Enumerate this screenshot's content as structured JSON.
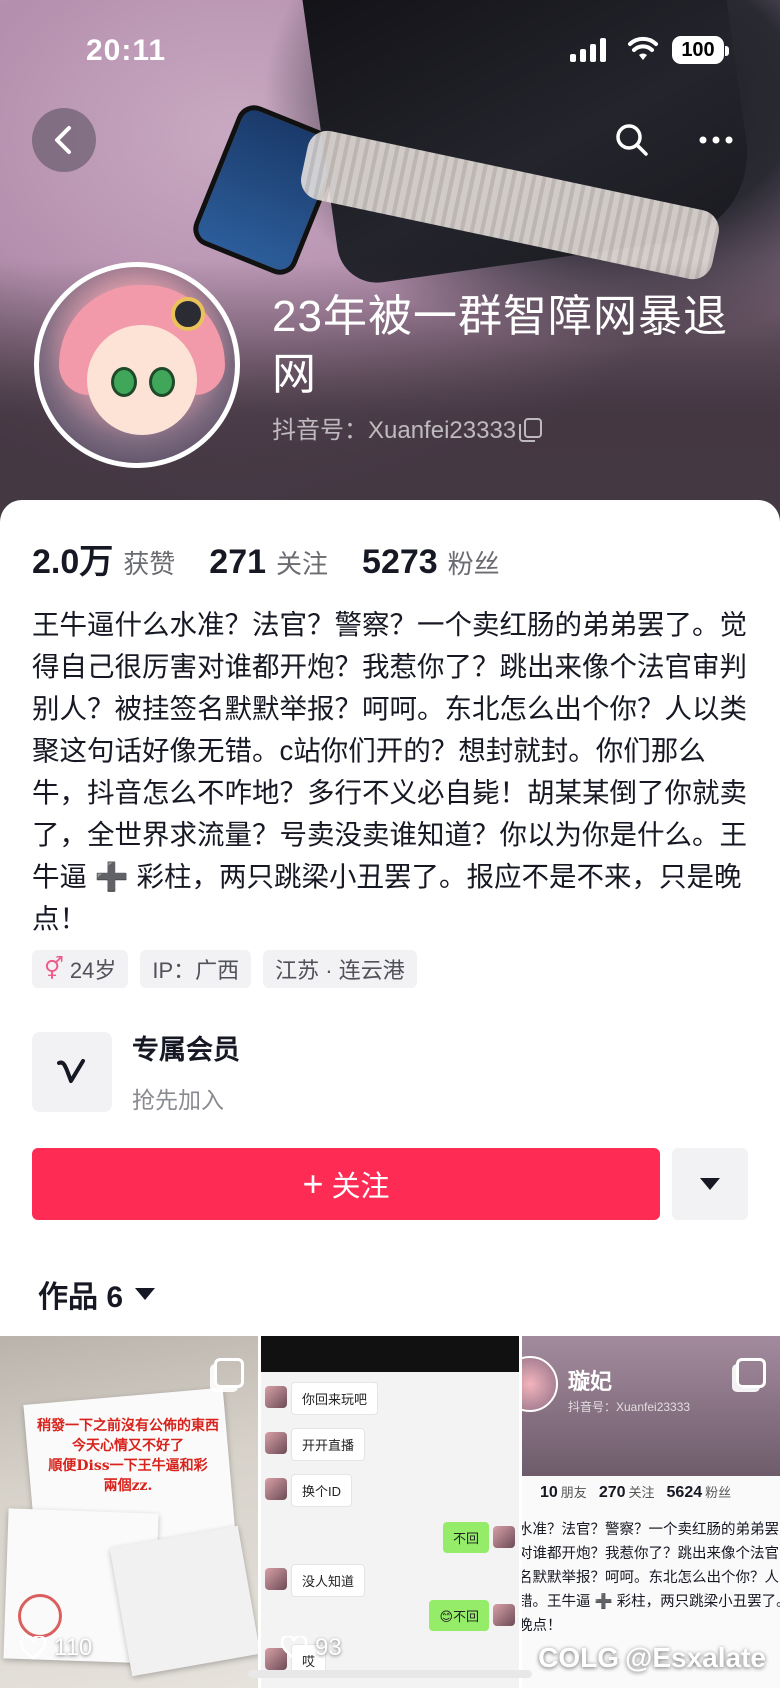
{
  "status_bar": {
    "time": "20:11",
    "battery": "100"
  },
  "profile": {
    "nickname": "23年被一群智障网暴退网",
    "douyin_id": "抖音号：Xuanfei23333"
  },
  "stats": [
    {
      "value": "2.0万",
      "label": "获赞"
    },
    {
      "value": "271",
      "label": "关注"
    },
    {
      "value": "5273",
      "label": "粉丝"
    }
  ],
  "bio": "王牛逼什么水准？法官？警察？一个卖红肠的弟弟罢了。觉得自己很厉害对谁都开炮？我惹你了？跳出来像个法官审判别人？被挂签名默默举报？呵呵。东北怎么出个你？人以类聚这句话好像无错。c站你们开的？想封就封。你们那么牛，抖音怎么不咋地？多行不义必自毙！胡某某倒了你就卖了，全世界求流量？号卖没卖谁知道？你以为你是什么。王牛逼 ➕ 彩柱，两只跳梁小丑罢了。报应不是不来，只是晚点！",
  "tags": {
    "age": "24岁",
    "ip": "IP：广西",
    "location": "江苏 · 连云港"
  },
  "member": {
    "title": "专属会员",
    "subtitle": "抢先加入"
  },
  "follow_button": {
    "plus": "+",
    "label": "关注"
  },
  "works_tab": {
    "label": "作品 6"
  },
  "grid": {
    "cell1": {
      "likes": "110",
      "note": "稍發一下之前沒有公佈的東西\n今天心情又不好了\n順便Diss一下王牛逼和彩\n兩個zz."
    },
    "cell2": {
      "likes": "93",
      "messages": [
        "你回来玩吧",
        "开开直播",
        "换个ID",
        "不回",
        "没人知道",
        "😊不回",
        "哎"
      ]
    },
    "cell3": {
      "name": "璇妃",
      "id": "抖音号：Xuanfei23333",
      "stats": [
        {
          "value": "10",
          "label": "朋友"
        },
        {
          "value": "270",
          "label": "关注"
        },
        {
          "value": "5624",
          "label": "粉丝"
        }
      ],
      "bio_lines": [
        "水准？法官？警察？一个卖红肠的弟弟罢",
        "对谁都开炮？我惹你了？跳出来像个法官",
        "名默默举报？呵呵。东北怎么出个你？人",
        "错。王牛逼 ➕ 彩柱，两只跳梁小丑罢了。",
        "晚点！"
      ]
    }
  },
  "watermark": {
    "logo": "COLG",
    "handle": "@Esxalate"
  },
  "colors": {
    "accent": "#fe2c55",
    "text": "#161823",
    "muted": "#6b6c72"
  },
  "icons": [
    "back-arrow-icon",
    "search-icon",
    "more-icon",
    "copy-icon",
    "gender-icon",
    "member-v-icon",
    "caret-down-icon",
    "multi-image-icon",
    "heart-icon"
  ]
}
